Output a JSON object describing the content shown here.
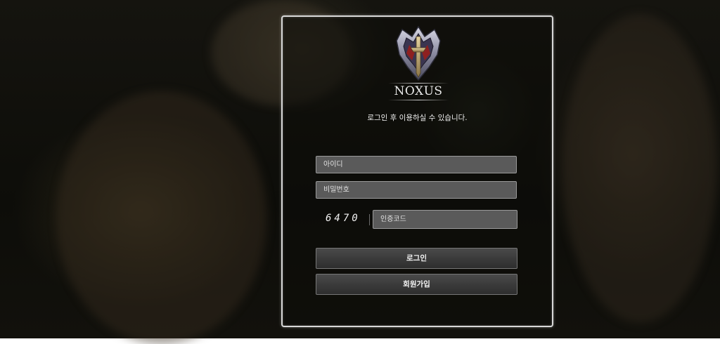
{
  "brand": {
    "name": "NOXUS",
    "emblem_icon": "noxus-crest-icon"
  },
  "notice": "로그인 후 이용하실 수 있습니다.",
  "form": {
    "id_placeholder": "아이디",
    "password_placeholder": "비밀번호",
    "captcha_code": "6470",
    "captcha_placeholder": "인증코드",
    "login_label": "로그인",
    "signup_label": "회원가입"
  },
  "colors": {
    "panel_border": "#d8d8d8",
    "field_bg": "#5a5a5a",
    "button_bg": "#3b3b3b"
  }
}
